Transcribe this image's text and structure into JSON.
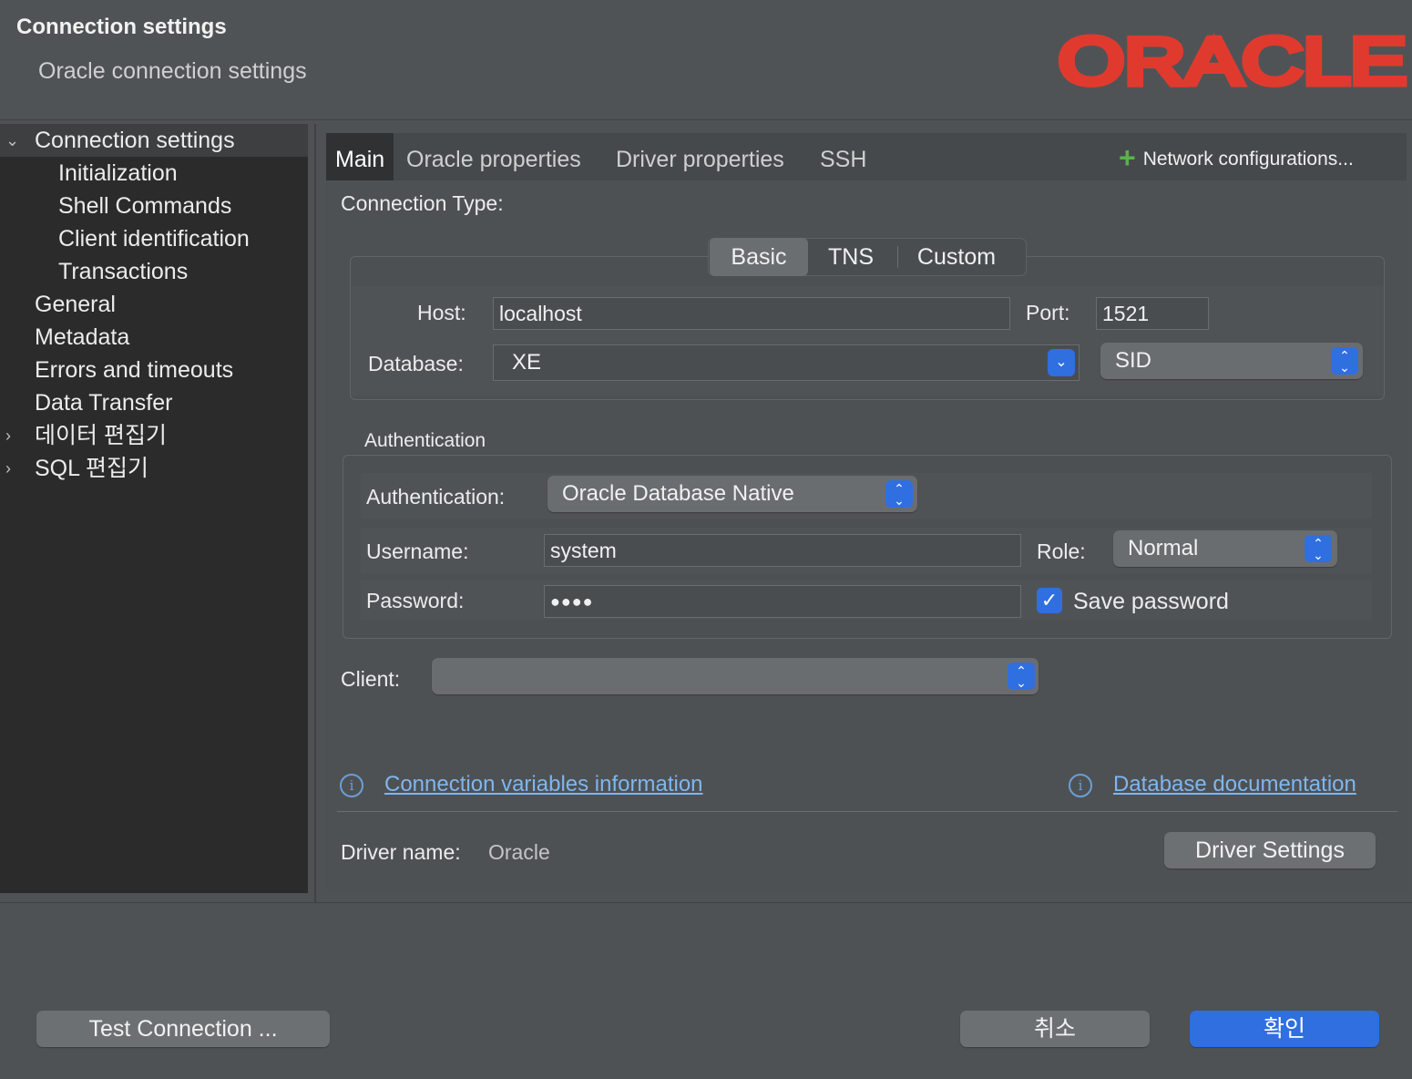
{
  "header": {
    "title": "Connection settings",
    "subtitle": "Oracle connection settings",
    "logo_text": "ORACLE",
    "logo_color": "#e03a2e"
  },
  "tree": {
    "items": [
      {
        "label": "Connection settings",
        "expanded": true,
        "selected": true
      },
      {
        "label": "Initialization"
      },
      {
        "label": "Shell Commands"
      },
      {
        "label": "Client identification"
      },
      {
        "label": "Transactions"
      },
      {
        "label": "General"
      },
      {
        "label": "Metadata"
      },
      {
        "label": "Errors and timeouts"
      },
      {
        "label": "Data Transfer"
      },
      {
        "label": "데이터 편집기",
        "expandable": true
      },
      {
        "label": "SQL 편집기",
        "expandable": true
      }
    ]
  },
  "tabs": {
    "items": [
      "Main",
      "Oracle properties",
      "Driver properties",
      "SSH"
    ],
    "active": "Main",
    "network_config_label": "Network configurations..."
  },
  "main": {
    "connection_type_label": "Connection Type:",
    "connection_types": [
      "Basic",
      "TNS",
      "Custom"
    ],
    "connection_type_selected": "Basic",
    "host_label": "Host:",
    "host_value": "localhost",
    "port_label": "Port:",
    "port_value": "1521",
    "database_label": "Database:",
    "database_value": "XE",
    "sid_value": "SID",
    "auth_group_title": "Authentication",
    "auth_label": "Authentication:",
    "auth_value": "Oracle Database Native",
    "username_label": "Username:",
    "username_value": "system",
    "role_label": "Role:",
    "role_value": "Normal",
    "password_label": "Password:",
    "password_value": "●●●●",
    "save_password_label": "Save password",
    "save_password_checked": true,
    "client_label": "Client:",
    "client_value": "",
    "conn_vars_link": "Connection variables information",
    "db_docs_link": "Database documentation",
    "driver_name_label": "Driver name:",
    "driver_name_value": "Oracle",
    "driver_settings_button": "Driver Settings"
  },
  "footer": {
    "test_connection_button": "Test Connection ...",
    "cancel_button": "취소",
    "ok_button": "확인",
    "accent_color": "#2f6fe0"
  }
}
